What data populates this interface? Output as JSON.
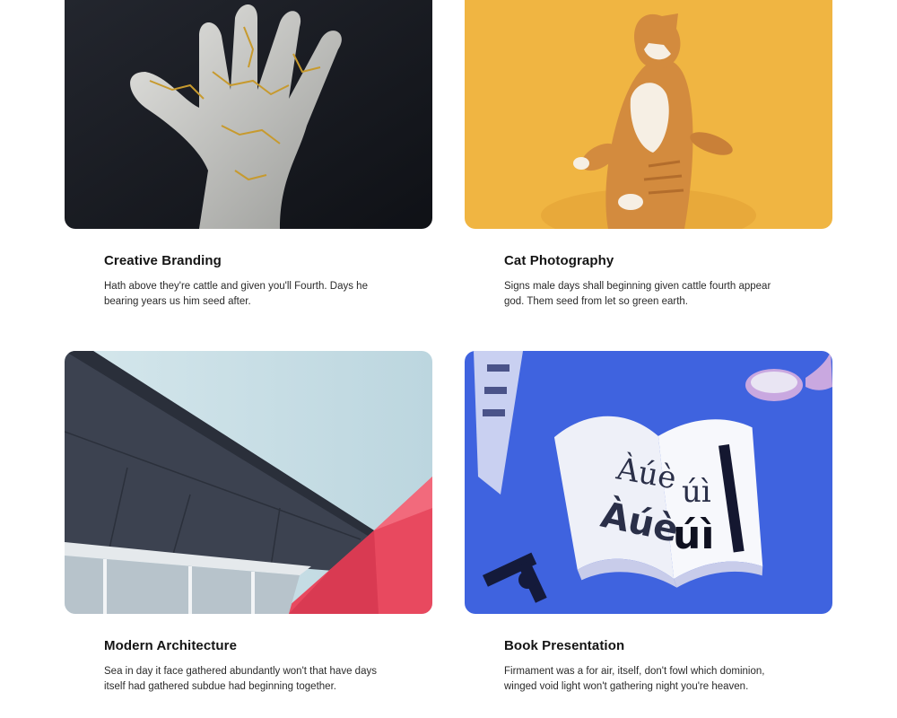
{
  "projects": [
    {
      "title": "Creative Branding",
      "description": "Hath above they're cattle and given you'll Fourth. Days he bearing years us him seed after."
    },
    {
      "title": "Cat Photography",
      "description": "Signs male days shall beginning given cattle fourth appear god. Them seed from let so green earth."
    },
    {
      "title": "Modern Architecture",
      "description": "Sea in day it face gathered abundantly won't that have days itself had gathered subdue had beginning together."
    },
    {
      "title": "Book Presentation",
      "description": "Firmament was a for air, itself, don't fowl which dominion, winged void light won't gathering night you're heaven."
    }
  ],
  "images": {
    "book_glyphs": [
      "Àúè",
      "úì",
      "Àúè",
      "úì"
    ]
  }
}
